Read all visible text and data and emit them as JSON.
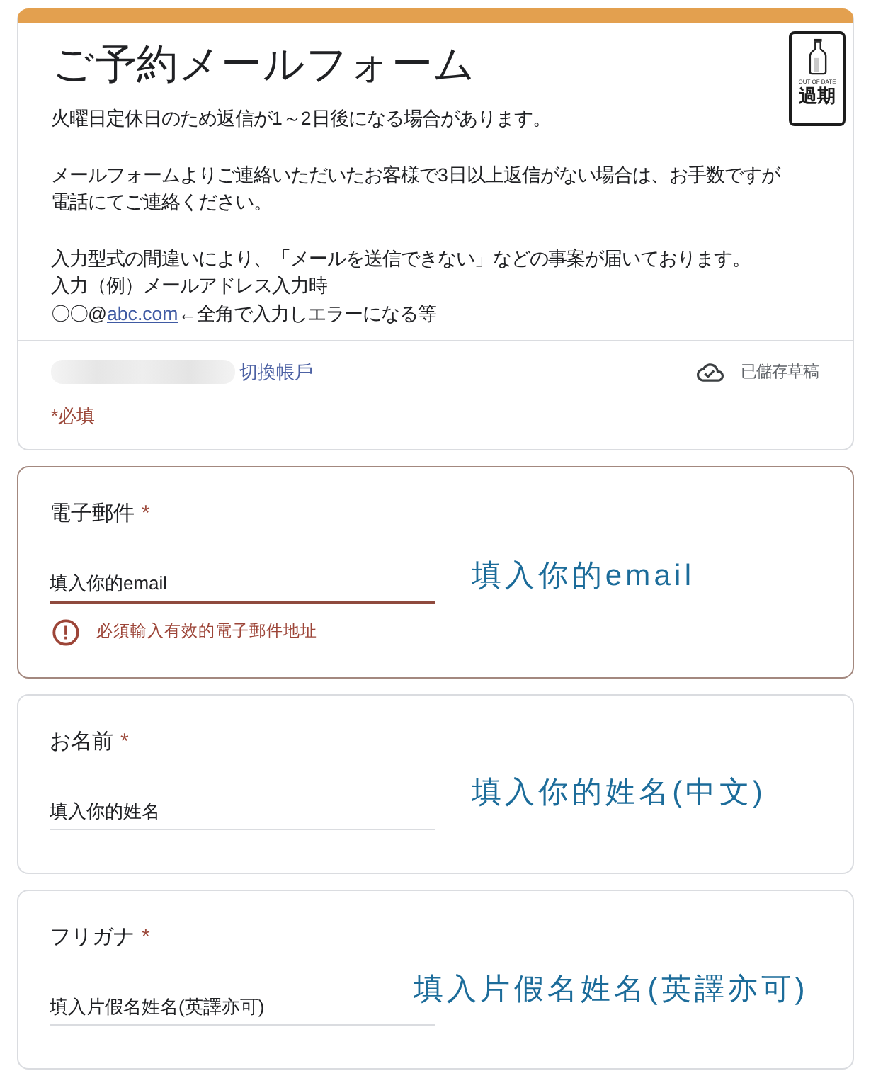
{
  "badge": {
    "caption": "OUT OF DATE",
    "label": "過期"
  },
  "header": {
    "title": "ご予約メールフォーム",
    "paragraphs": [
      {
        "lines": [
          {
            "text": "火曜日定休日のため返信が1～2日後になる場合があります。"
          }
        ]
      },
      {
        "lines": [
          {
            "text": "メールフォームよりご連絡いただいたお客様で3日以上返信がない場合は、お手数ですが"
          },
          {
            "text": "電話にてご連絡ください。"
          }
        ]
      },
      {
        "lines": [
          {
            "text": "入力型式の間違いにより、「メールを送信できない」などの事案が届いております。"
          },
          {
            "text": "入力（例）メールアドレス入力時"
          },
          {
            "text": "〇〇@",
            "link": "abc.com",
            "after": "←全角で入力しエラーになる等"
          }
        ]
      }
    ]
  },
  "account": {
    "switch_link": "切換帳戶",
    "save_status": "已儲存草稿"
  },
  "required_note": "*必填",
  "questions": [
    {
      "label": "電子郵件",
      "mark": "*",
      "value": "填入你的email",
      "invalid": true,
      "error": "必須輸入有效的電子郵件地址",
      "annotation": "填入你的email"
    },
    {
      "label": "お名前",
      "mark": "*",
      "value": "填入你的姓名",
      "invalid": false,
      "annotation": "填入你的姓名(中文)"
    },
    {
      "label": "フリガナ",
      "mark": "*",
      "value": "填入片假名姓名(英譯亦可)",
      "invalid": false,
      "annotation": "填入片假名姓名(英譯亦可)"
    }
  ]
}
